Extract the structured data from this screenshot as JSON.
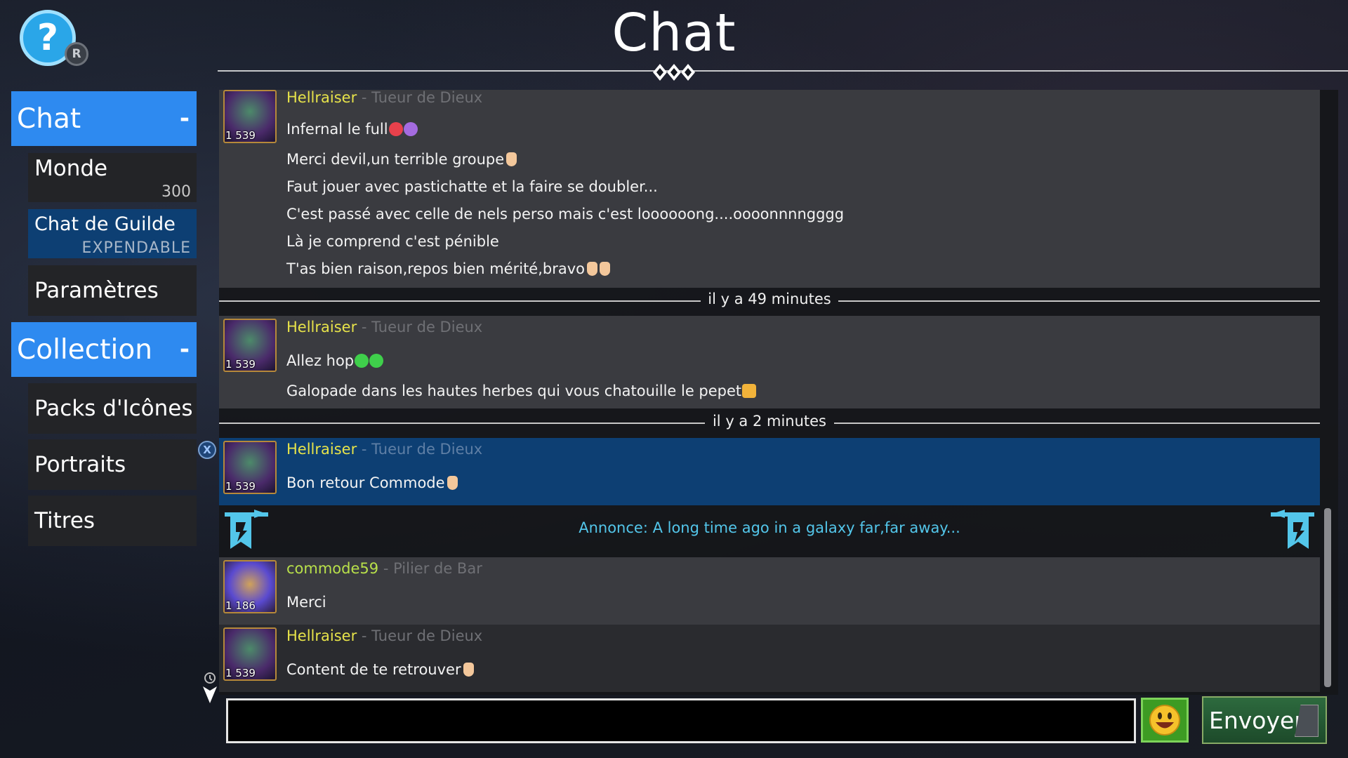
{
  "header": {
    "title": "Chat",
    "help_icon": "question-mark-icon",
    "help_key": "R"
  },
  "sidebar": {
    "chat_header": "Chat",
    "chat_collapse": "-",
    "monde_label": "Monde",
    "monde_count": "300",
    "guild_label": "Chat de Guilde",
    "guild_sub": "EXPENDABLE",
    "settings_label": "Paramètres",
    "collection_header": "Collection",
    "collection_collapse": "-",
    "packs_label": "Packs d'Icônes",
    "portraits_label": "Portraits",
    "titles_label": "Titres",
    "close_glyph": "X"
  },
  "messages": [
    {
      "author": "Hellraiser",
      "rank": " - Tueur de Dieux",
      "level": "1 539",
      "lines": [
        "Infernal le full",
        "Merci devil,un terrible groupe",
        "Faut jouer avec pastichatte et la faire se doubler...",
        "C'est passé avec celle de nels perso mais c'est loooooong....oooonnnngggg",
        "Là je comprend c'est pénible",
        "T'as bien raison,repos bien mérité,bravo"
      ]
    },
    {
      "divider": "il y a 49 minutes"
    },
    {
      "author": "Hellraiser",
      "rank": " - Tueur de Dieux",
      "level": "1 539",
      "lines": [
        "Allez hop",
        "Galopade dans les hautes herbes qui vous chatouille le pepet"
      ]
    },
    {
      "divider": "il y a 2 minutes"
    },
    {
      "author": "Hellraiser",
      "rank": " - Tueur de Dieux",
      "level": "1 539",
      "lines": [
        "Bon retour Commode"
      ]
    },
    {
      "announcement": "Annonce: A long time ago in a galaxy far,far away..."
    },
    {
      "author": "commode59",
      "rank": " - Pilier de Bar",
      "level": "1 186",
      "lines": [
        "Merci"
      ]
    },
    {
      "author": "Hellraiser",
      "rank": " - Tueur de Dieux",
      "level": "1 539",
      "lines": [
        "Content de te retrouver"
      ]
    }
  ],
  "input": {
    "value": "",
    "placeholder": ""
  },
  "send_label": "Envoyer",
  "colors": {
    "accent_blue": "#2e8af0",
    "highlight": "#0d3f73",
    "author_yellow": "#e7e34a",
    "author_green": "#b8e04a",
    "announcement": "#53c6ea",
    "send_green": "#2d6a3e"
  }
}
